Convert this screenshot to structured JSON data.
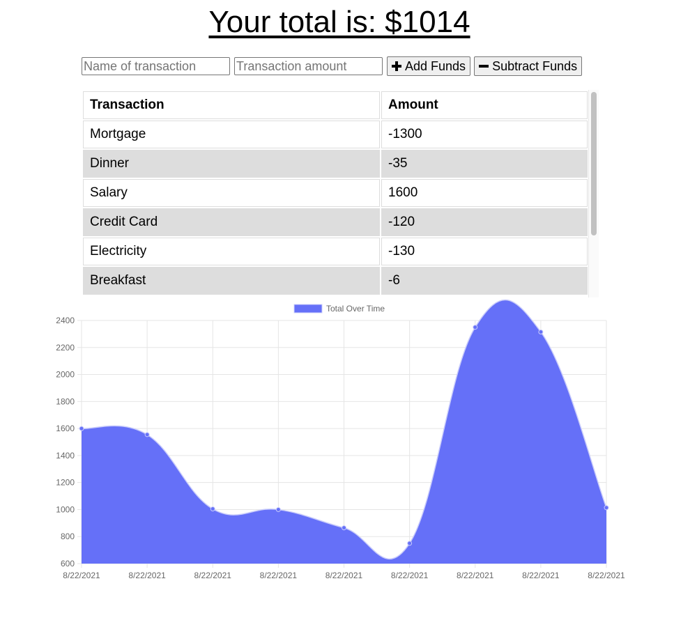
{
  "header": {
    "total_text": "Your total is: $1014"
  },
  "form": {
    "name_placeholder": "Name of transaction",
    "amount_placeholder": "Transaction amount",
    "add_label": "Add Funds",
    "subtract_label": "Subtract Funds"
  },
  "table": {
    "headers": [
      "Transaction",
      "Amount"
    ],
    "rows": [
      {
        "name": "Mortgage",
        "amount": "-1300"
      },
      {
        "name": "Dinner",
        "amount": "-35"
      },
      {
        "name": "Salary",
        "amount": "1600"
      },
      {
        "name": "Credit Card",
        "amount": "-120"
      },
      {
        "name": "Electricity",
        "amount": "-130"
      },
      {
        "name": "Breakfast",
        "amount": "-6"
      }
    ]
  },
  "colors": {
    "series_fill": "#6570f8",
    "series_point": "#6570f8"
  },
  "chart_data": {
    "type": "area",
    "x": [
      "8/22/2021",
      "8/22/2021",
      "8/22/2021",
      "8/22/2021",
      "8/22/2021",
      "8/22/2021",
      "8/22/2021",
      "8/22/2021",
      "8/22/2021"
    ],
    "series": [
      {
        "name": "Total Over Time",
        "values": [
          1600,
          1555,
          1005,
          1000,
          865,
          750,
          2350,
          2315,
          1014
        ]
      }
    ],
    "ylim": [
      600,
      2400
    ],
    "yticks": [
      600,
      800,
      1000,
      1200,
      1400,
      1600,
      1800,
      2000,
      2200,
      2400
    ],
    "grid": true,
    "legend": "top-center"
  }
}
